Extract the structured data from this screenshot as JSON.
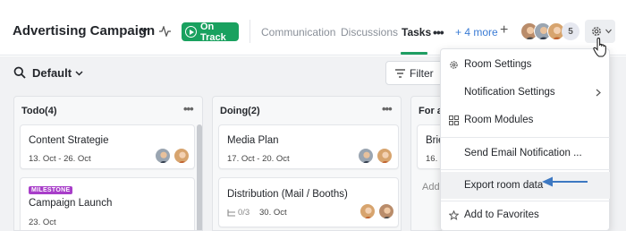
{
  "header": {
    "title": "Advertising Campaign",
    "status_label": "On Track",
    "status_color": "#19a15f",
    "nav": {
      "communication": "Communication",
      "discussions": "Discussions",
      "tasks": "Tasks",
      "more_dots": "•••",
      "more_label": "+ 4 more",
      "add_label": "+"
    },
    "members_extra_count": "5"
  },
  "toolbar": {
    "view_label": "Default",
    "filter_label": "Filter"
  },
  "columns": [
    {
      "title": "Todo(4)",
      "cards": [
        {
          "title": "Content Strategie",
          "date": "13. Oct - 26. Oct"
        },
        {
          "badge": "MILESTONE",
          "title": "Campaign Launch",
          "date": "23. Oct"
        }
      ]
    },
    {
      "title": "Doing(2)",
      "cards": [
        {
          "title": "Media Plan",
          "date": "17. Oct - 20. Oct"
        },
        {
          "title": "Distribution (Mail / Booths)",
          "subtasks": "0/3",
          "date": "30. Oct"
        }
      ]
    },
    {
      "title": "For a",
      "cards": [
        {
          "title": "Brie",
          "date": "16."
        }
      ],
      "add_label": "Add"
    }
  ],
  "menu": {
    "items": [
      {
        "label": "Room Settings",
        "icon": "gear-icon"
      },
      {
        "label": "Notification Settings",
        "icon": ""
      },
      {
        "label": "Room Modules",
        "icon": "modules-icon"
      },
      {
        "label": "Send Email Notification ...",
        "icon": ""
      },
      {
        "label": "Export room data",
        "icon": ""
      },
      {
        "label": "Add to Favorites",
        "icon": "star-icon"
      }
    ]
  },
  "colors": {
    "accent": "#1f9e63",
    "link": "#3a7bd5",
    "milestone": "#a83ec9",
    "annotation_arrow": "#3d78c2"
  }
}
